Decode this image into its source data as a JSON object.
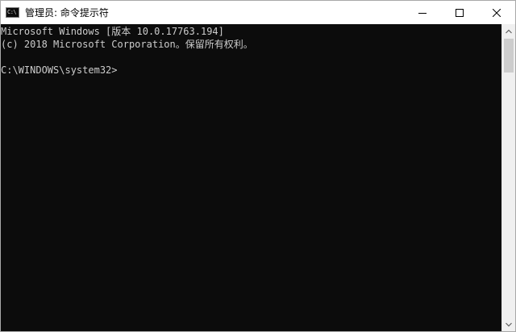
{
  "window": {
    "title": "管理员: 命令提示符",
    "icon_text": "C:\\"
  },
  "console": {
    "lines": [
      "Microsoft Windows [版本 10.0.17763.194]",
      "(c) 2018 Microsoft Corporation。保留所有权利。",
      "",
      "C:\\WINDOWS\\system32>"
    ]
  },
  "icons": {
    "app": "cmd-app-icon",
    "minimize": "minimize-icon",
    "maximize": "maximize-icon",
    "close": "close-icon",
    "scroll_up": "chevron-up-icon",
    "scroll_down": "chevron-down-icon"
  },
  "colors": {
    "console_bg": "#0c0c0c",
    "console_text": "#cccccc",
    "titlebar_bg": "#ffffff"
  }
}
